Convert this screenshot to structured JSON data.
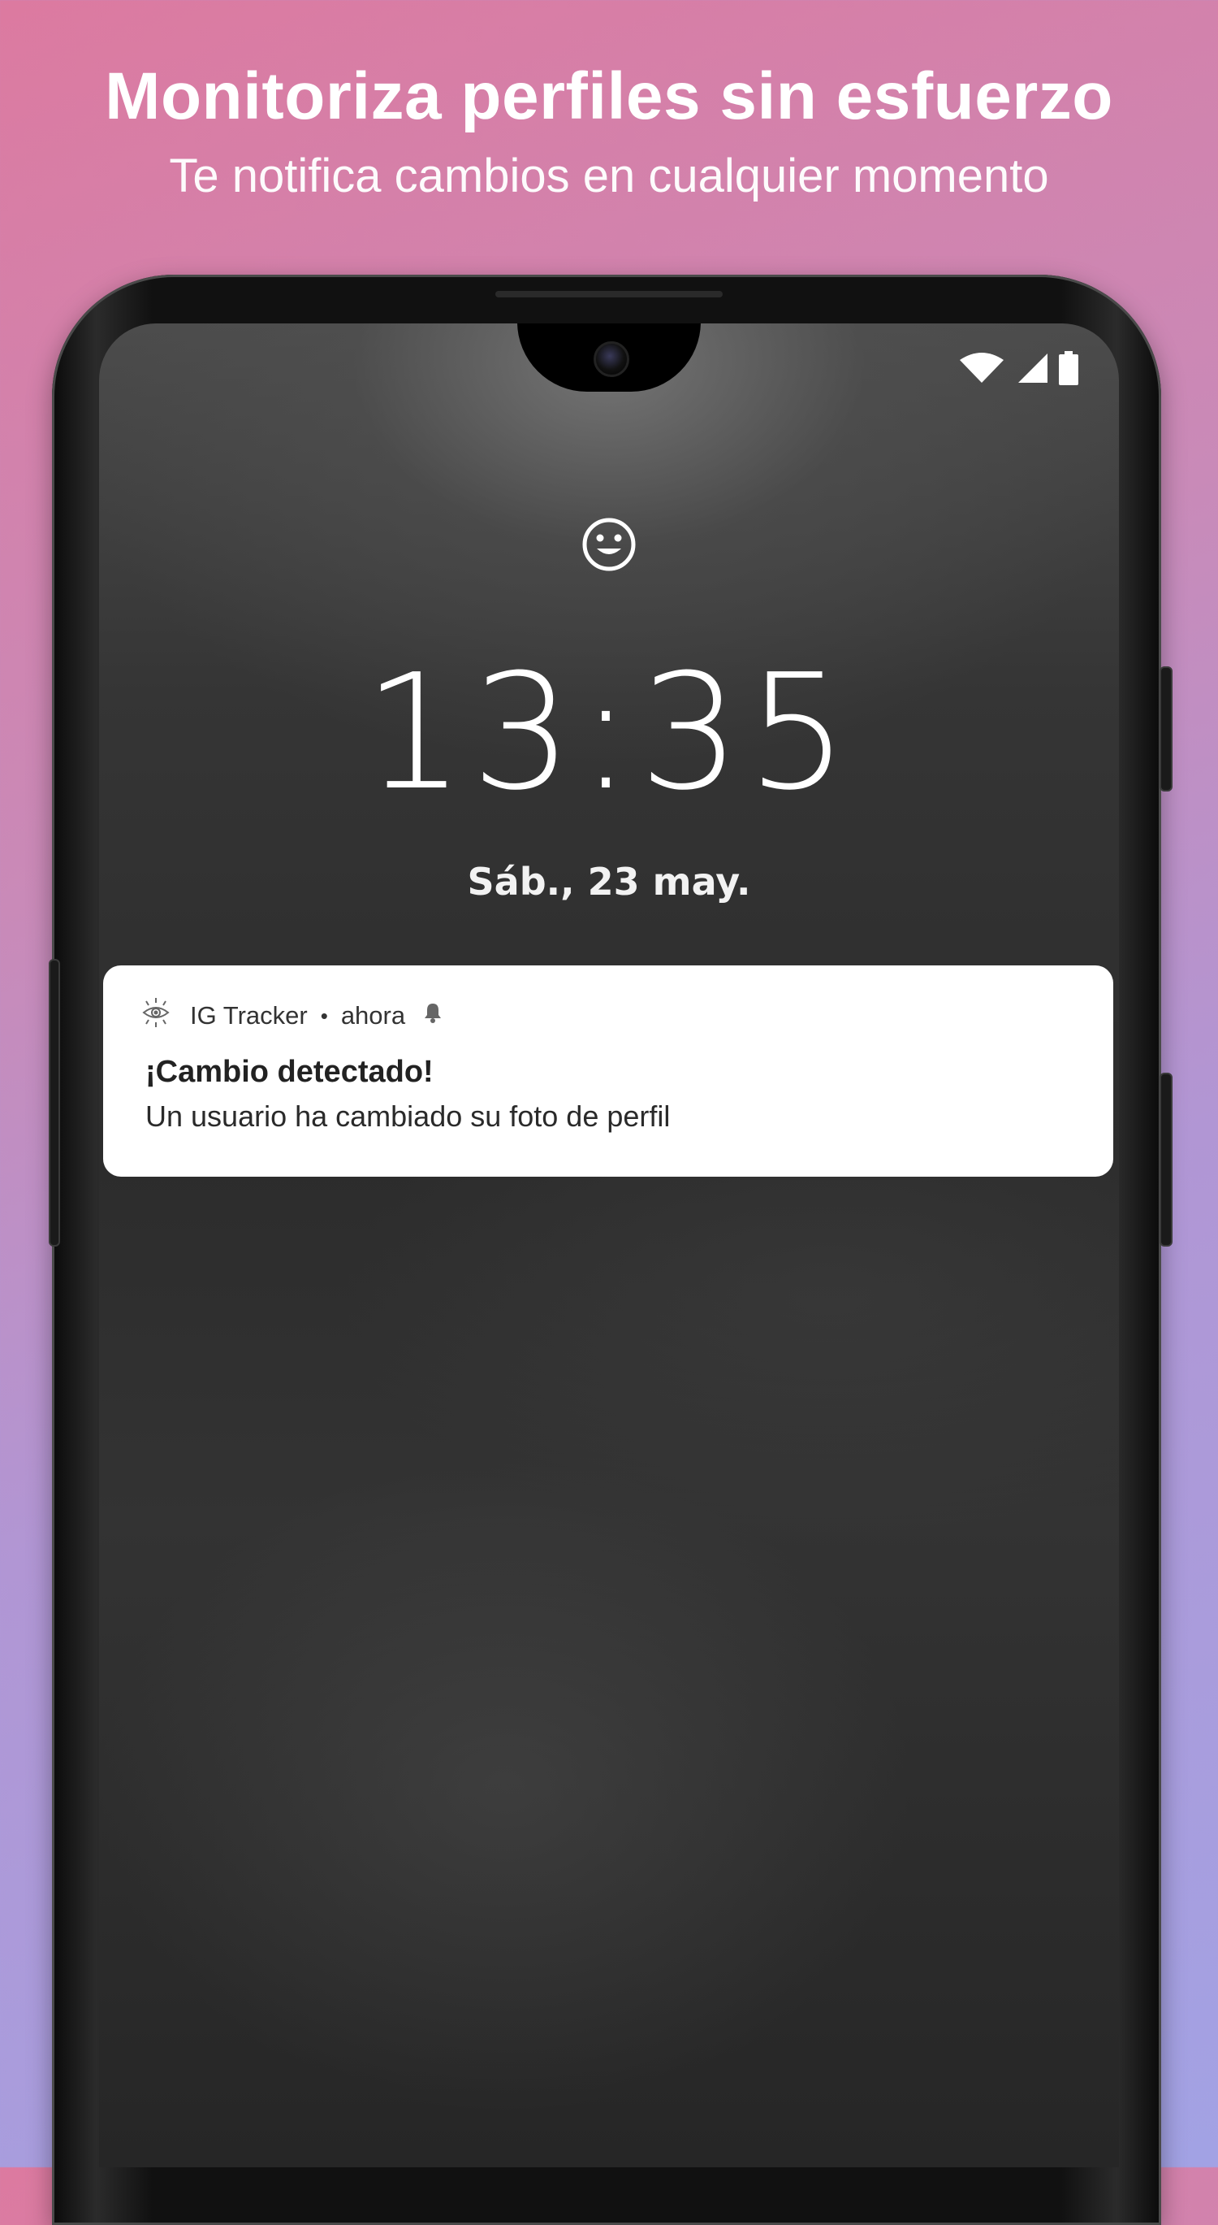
{
  "promo": {
    "title": "Monitoriza perfiles sin esfuerzo",
    "subtitle": "Te notifica cambios en cualquier momento"
  },
  "lockscreen": {
    "time": "13:35",
    "date": "Sáb., 23 may."
  },
  "notification": {
    "app_name": "IG Tracker",
    "separator": "•",
    "timestamp": "ahora",
    "title": "¡Cambio detectado!",
    "body": "Un usuario ha cambiado su foto de perfil"
  },
  "icons": {
    "status": [
      "wifi-icon",
      "signal-icon",
      "battery-icon"
    ],
    "lock_face": "smiley-icon",
    "app_icon": "eye-icon",
    "alert": "bell-icon"
  },
  "colors": {
    "gradient_top": "#dc7aa0",
    "gradient_bottom": "#a2a2e4",
    "notification_bg": "#ffffff",
    "text_light": "#ffffff"
  }
}
